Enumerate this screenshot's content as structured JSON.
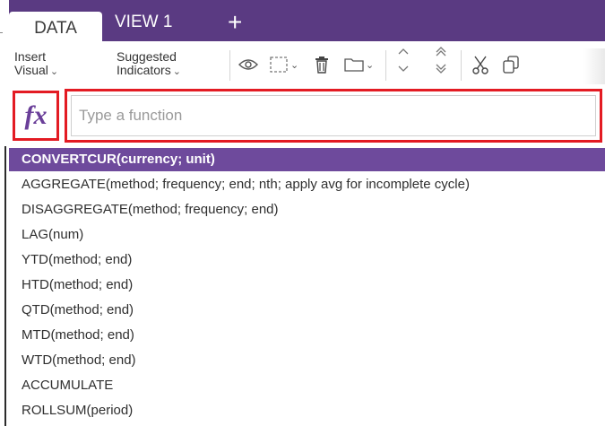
{
  "tabs": [
    {
      "label": "DATA",
      "active": true
    },
    {
      "label": "VIEW 1",
      "active": false
    }
  ],
  "add_tab_label": "+",
  "toolbar": {
    "insert_visual": {
      "line1": "Insert",
      "line2": "Visual"
    },
    "suggested_indicators": {
      "line1": "Suggested",
      "line2": "Indicators"
    },
    "icons": [
      "eye-icon",
      "select-icon",
      "trash-icon",
      "folder-icon",
      "move-up-icon",
      "move-top-icon",
      "cut-icon",
      "copy-icon"
    ]
  },
  "formula": {
    "fx_label": "fx",
    "placeholder": "Type a function"
  },
  "functions": [
    "CONVERTCUR(currency; unit)",
    "AGGREGATE(method; frequency; end; nth; apply avg for incomplete cycle)",
    "DISAGGREGATE(method; frequency; end)",
    "LAG(num)",
    "YTD(method; end)",
    "HTD(method; end)",
    "QTD(method; end)",
    "MTD(method; end)",
    "WTD(method; end)",
    "ACCUMULATE",
    "ROLLSUM(period)"
  ],
  "colors": {
    "tabbar": "#5a3a82",
    "highlight": "#6e4a9c",
    "annotation": "#e31b23",
    "fx": "#6a3f99"
  }
}
